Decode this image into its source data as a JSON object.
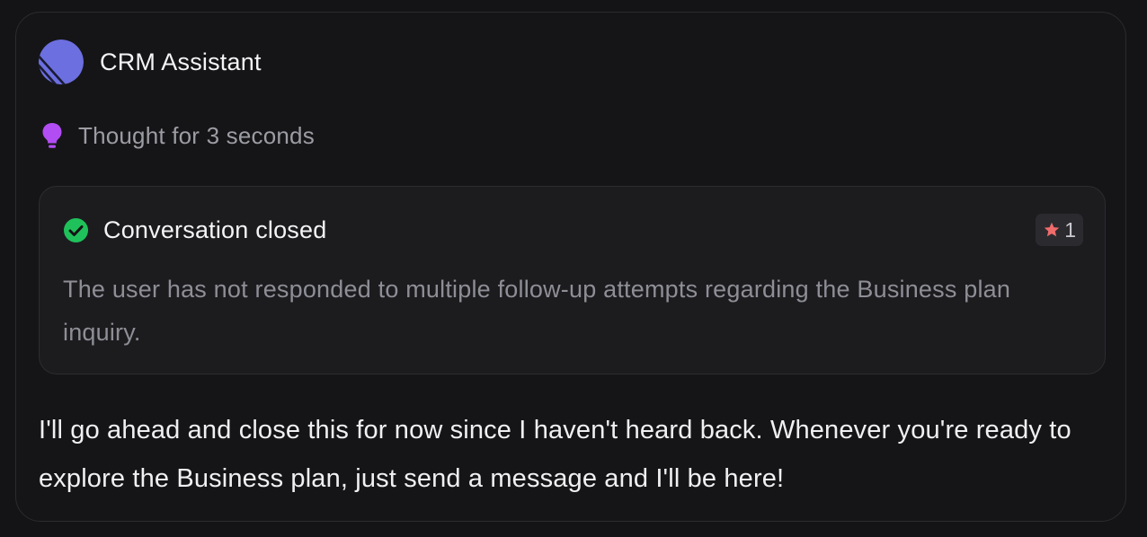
{
  "assistant": {
    "name": "CRM Assistant",
    "avatar_icon": "striped-circle-logo"
  },
  "thought": {
    "icon": "lightbulb-icon",
    "text": "Thought for 3 seconds"
  },
  "event": {
    "status_icon": "check-circle-icon",
    "title": "Conversation closed",
    "rating": {
      "icon": "star-icon",
      "count": "1"
    },
    "description": "The user has not responded to multiple follow-up attempts regarding the Business plan inquiry."
  },
  "reply": {
    "text": "I'll go ahead and close this for now since I haven't heard back. Whenever you're ready to explore the Business plan, just send a message and I'll be here!"
  },
  "colors": {
    "background": "#141416",
    "card": "#151517",
    "event_card": "#1c1c1f",
    "avatar": "#6c6fe0",
    "bulb": "#b14df2",
    "check": "#1fc25a",
    "star": "#f06b6b",
    "muted_text": "#8e8e96"
  }
}
